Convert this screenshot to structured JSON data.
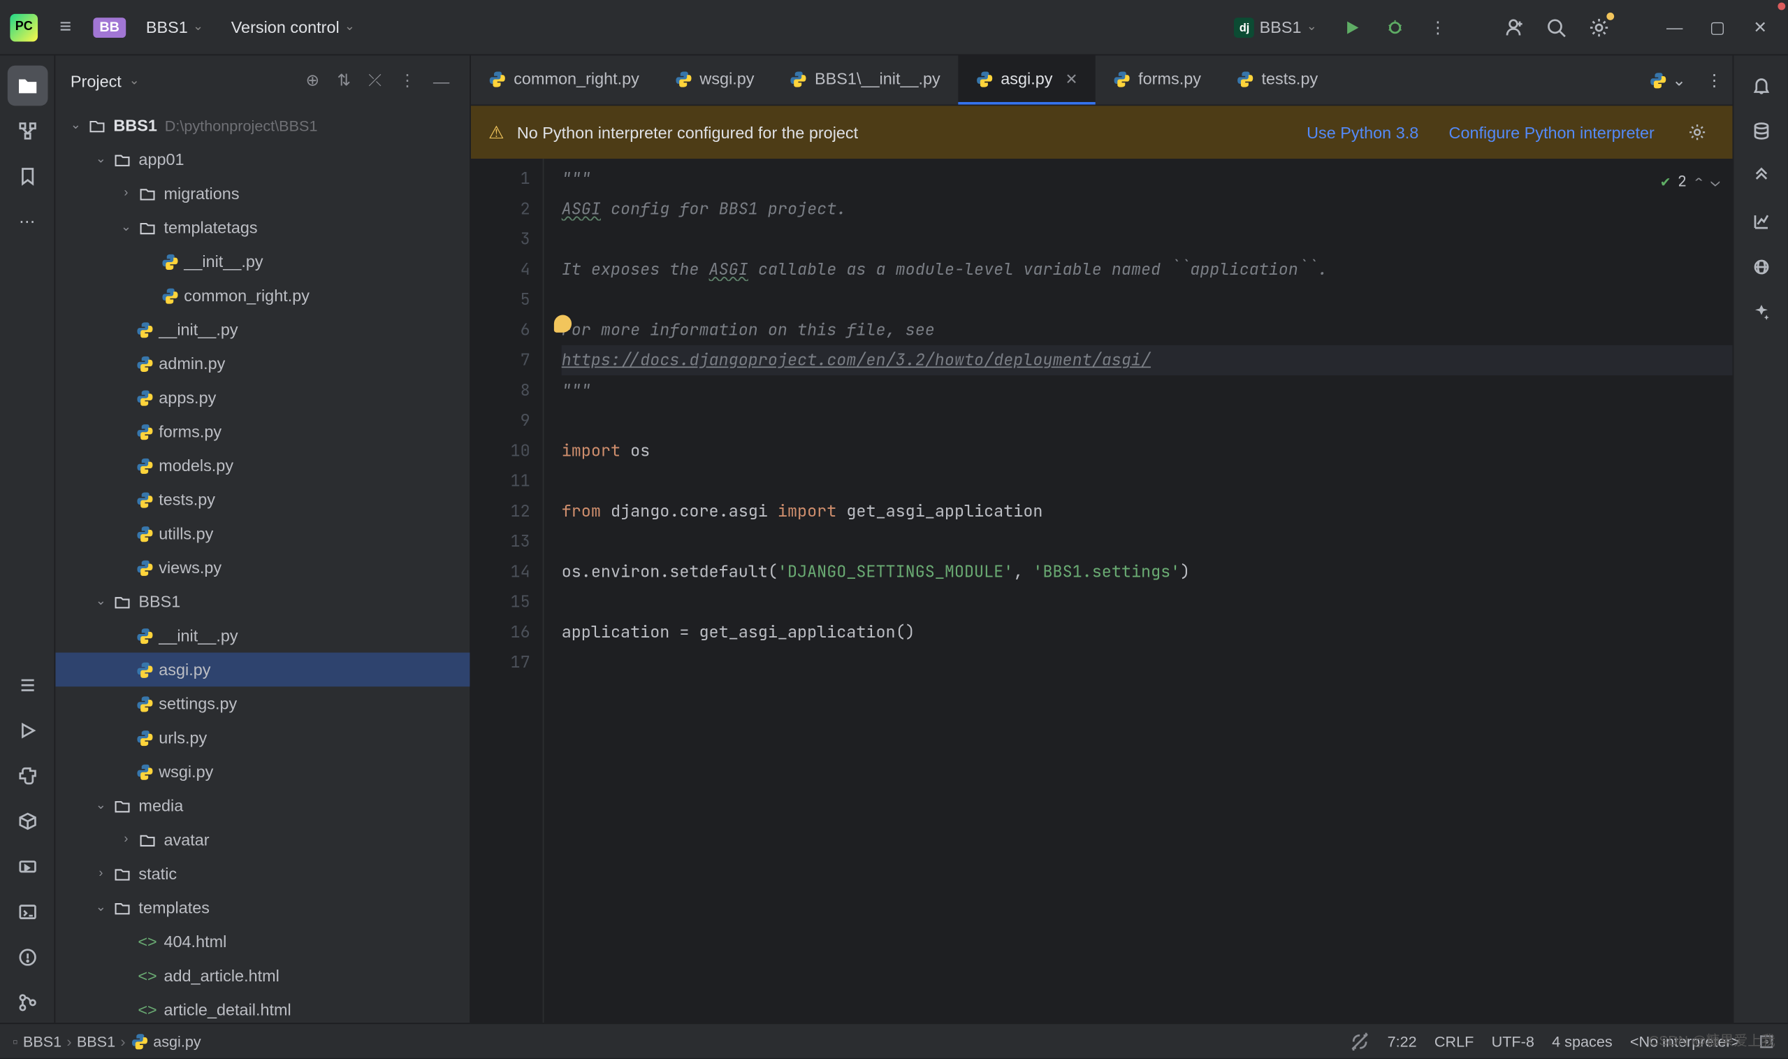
{
  "titlebar": {
    "project_badge": "BB",
    "project_name": "BBS1",
    "vcs_label": "Version control",
    "run_config": "BBS1"
  },
  "window_controls": {
    "min": "—",
    "max": "▢",
    "close": "✕"
  },
  "project_panel": {
    "title": "Project",
    "root": {
      "name": "BBS1",
      "path": "D:\\pythonproject\\BBS1"
    },
    "tree": [
      {
        "depth": 0,
        "arrow": "v",
        "icon": "folder",
        "label": "BBS1",
        "bold": true,
        "path": "D:\\pythonproject\\BBS1"
      },
      {
        "depth": 1,
        "arrow": "v",
        "icon": "folder",
        "label": "app01"
      },
      {
        "depth": 2,
        "arrow": ">",
        "icon": "folder",
        "label": "migrations"
      },
      {
        "depth": 2,
        "arrow": "v",
        "icon": "folder",
        "label": "templatetags"
      },
      {
        "depth": 3,
        "arrow": "",
        "icon": "py",
        "label": "__init__.py"
      },
      {
        "depth": 3,
        "arrow": "",
        "icon": "py",
        "label": "common_right.py"
      },
      {
        "depth": 2,
        "arrow": "",
        "icon": "py",
        "label": "__init__.py"
      },
      {
        "depth": 2,
        "arrow": "",
        "icon": "py",
        "label": "admin.py"
      },
      {
        "depth": 2,
        "arrow": "",
        "icon": "py",
        "label": "apps.py"
      },
      {
        "depth": 2,
        "arrow": "",
        "icon": "py",
        "label": "forms.py"
      },
      {
        "depth": 2,
        "arrow": "",
        "icon": "py",
        "label": "models.py"
      },
      {
        "depth": 2,
        "arrow": "",
        "icon": "py",
        "label": "tests.py"
      },
      {
        "depth": 2,
        "arrow": "",
        "icon": "py",
        "label": "utills.py"
      },
      {
        "depth": 2,
        "arrow": "",
        "icon": "py",
        "label": "views.py"
      },
      {
        "depth": 1,
        "arrow": "v",
        "icon": "folder",
        "label": "BBS1"
      },
      {
        "depth": 2,
        "arrow": "",
        "icon": "py",
        "label": "__init__.py"
      },
      {
        "depth": 2,
        "arrow": "",
        "icon": "py",
        "label": "asgi.py",
        "selected": true
      },
      {
        "depth": 2,
        "arrow": "",
        "icon": "py",
        "label": "settings.py"
      },
      {
        "depth": 2,
        "arrow": "",
        "icon": "py",
        "label": "urls.py"
      },
      {
        "depth": 2,
        "arrow": "",
        "icon": "py",
        "label": "wsgi.py"
      },
      {
        "depth": 1,
        "arrow": "v",
        "icon": "folder",
        "label": "media"
      },
      {
        "depth": 2,
        "arrow": ">",
        "icon": "folder",
        "label": "avatar"
      },
      {
        "depth": 1,
        "arrow": ">",
        "icon": "folder",
        "label": "static"
      },
      {
        "depth": 1,
        "arrow": "v",
        "icon": "folder",
        "label": "templates"
      },
      {
        "depth": 2,
        "arrow": "",
        "icon": "html",
        "label": "404.html"
      },
      {
        "depth": 2,
        "arrow": "",
        "icon": "html",
        "label": "add_article.html"
      },
      {
        "depth": 2,
        "arrow": "",
        "icon": "html",
        "label": "article_detail.html"
      }
    ]
  },
  "tabs": [
    {
      "label": "common_right.py",
      "icon": "py"
    },
    {
      "label": "wsgi.py",
      "icon": "py"
    },
    {
      "label": "BBS1\\__init__.py",
      "icon": "py"
    },
    {
      "label": "asgi.py",
      "icon": "py",
      "active": true,
      "closable": true
    },
    {
      "label": "forms.py",
      "icon": "py"
    },
    {
      "label": "tests.py",
      "icon": "py"
    }
  ],
  "notification": {
    "text": "No Python interpreter configured for the project",
    "link1": "Use Python 3.8",
    "link2": "Configure Python interpreter"
  },
  "inspection": {
    "count": "2"
  },
  "code_lines": [
    {
      "n": 1,
      "html": "<span class='c-comment'>\"\"\"</span>"
    },
    {
      "n": 2,
      "html": "<span class='c-comment'><span class='c-underline'>ASGI</span> config for BBS1 project.</span>"
    },
    {
      "n": 3,
      "html": ""
    },
    {
      "n": 4,
      "html": "<span class='c-comment'>It exposes the <span class='c-underline'>ASGI</span> callable as a module-level variable named ``application``.</span>"
    },
    {
      "n": 5,
      "html": ""
    },
    {
      "n": 6,
      "html": "<span class='c-comment'>For more information on this file, see</span>"
    },
    {
      "n": 7,
      "html": "<span class='c-link'>https://docs.djangoproject.com/en/3.2/howto/deployment/asgi/</span>",
      "current": true
    },
    {
      "n": 8,
      "html": "<span class='c-comment'>\"\"\"</span>"
    },
    {
      "n": 9,
      "html": ""
    },
    {
      "n": 10,
      "html": "<span class='c-kw'>import</span> os"
    },
    {
      "n": 11,
      "html": ""
    },
    {
      "n": 12,
      "html": "<span class='c-kw'>from</span> django.core.asgi <span class='c-kw'>import</span> get_asgi_application"
    },
    {
      "n": 13,
      "html": ""
    },
    {
      "n": 14,
      "html": "os.environ.setdefault(<span class='c-str'>'DJANGO_SETTINGS_MODULE'</span>, <span class='c-str'>'BBS1.settings'</span>)"
    },
    {
      "n": 15,
      "html": ""
    },
    {
      "n": 16,
      "html": "application = get_asgi_application()"
    },
    {
      "n": 17,
      "html": ""
    }
  ],
  "breadcrumb": [
    "BBS1",
    "BBS1",
    "asgi.py"
  ],
  "status": {
    "pos": "7:22",
    "sep": "CRLF",
    "enc": "UTF-8",
    "indent": "4 spaces",
    "interp": "<No interpreter>"
  },
  "watermark": "CSDN @糠果爱上我"
}
